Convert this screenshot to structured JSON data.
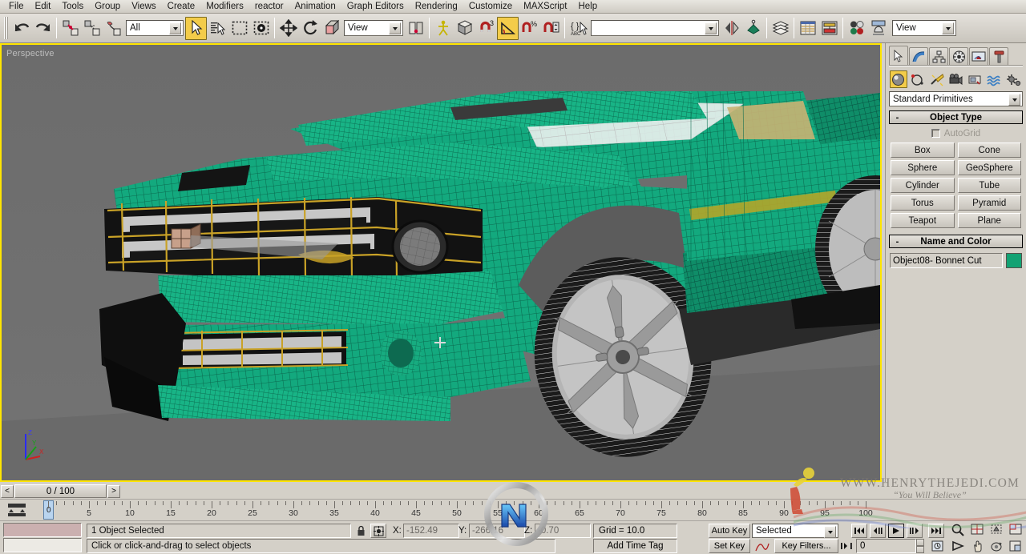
{
  "app": {
    "title": "3ds Max",
    "accent": "#f3cc4a",
    "viewport_border": "#ffe500"
  },
  "menubar": {
    "items": [
      "File",
      "Edit",
      "Tools",
      "Group",
      "Views",
      "Create",
      "Modifiers",
      "reactor",
      "Animation",
      "Graph Editors",
      "Rendering",
      "Customize",
      "MAXScript",
      "Help"
    ]
  },
  "toolbar": {
    "selection_filter": {
      "value": "All",
      "label": "Selection Filter"
    },
    "reference_coord": {
      "value": "View",
      "label": "Reference Coordinate System"
    },
    "named_selection": {
      "value": "",
      "placeholder": ""
    },
    "viewport_layout": {
      "value": "View"
    },
    "icons": [
      "undo-icon",
      "redo-icon",
      "select-link-icon",
      "unlink-icon",
      "bind-space-warp-icon",
      "select-object-icon",
      "select-by-name-icon",
      "rectangular-region-icon",
      "window-crossing-icon",
      "select-and-move-icon",
      "select-and-rotate-icon",
      "select-and-scale-icon",
      "use-pivot-center-icon",
      "select-and-manipulate-icon",
      "snaps-toggle-icon",
      "angle-snap-icon",
      "percent-snap-icon",
      "spinner-snap-icon",
      "named-selection-sets-icon",
      "mirror-icon",
      "align-icon",
      "layer-manager-icon",
      "curve-editor-icon",
      "schematic-view-icon",
      "material-editor-icon",
      "render-setup-icon"
    ]
  },
  "viewport": {
    "label": "Perspective",
    "background": "#6e6e6e",
    "object_color": "#16b083",
    "accent_yellow": "#b09a1e",
    "axis_labels": {
      "x": "X",
      "y": "Y",
      "z": "Z"
    }
  },
  "command_panel": {
    "tabs": [
      {
        "name": "create",
        "icon": "arrow-create-icon",
        "active": true
      },
      {
        "name": "modify",
        "icon": "modify-icon",
        "active": false
      },
      {
        "name": "hierarchy",
        "icon": "hierarchy-icon",
        "active": false
      },
      {
        "name": "motion",
        "icon": "motion-icon",
        "active": false
      },
      {
        "name": "display",
        "icon": "display-icon",
        "active": false
      },
      {
        "name": "utilities",
        "icon": "hammer-icon",
        "active": false
      }
    ],
    "categories": [
      {
        "name": "geometry",
        "icon": "sphere-icon",
        "active": true
      },
      {
        "name": "shapes",
        "icon": "shapes-icon",
        "active": false
      },
      {
        "name": "lights",
        "icon": "light-icon",
        "active": false
      },
      {
        "name": "cameras",
        "icon": "camera-icon",
        "active": false
      },
      {
        "name": "helpers",
        "icon": "helpers-icon",
        "active": false
      },
      {
        "name": "space-warps",
        "icon": "wave-icon",
        "active": false
      },
      {
        "name": "systems",
        "icon": "systems-icon",
        "active": false
      }
    ],
    "category_dropdown": {
      "value": "Standard Primitives"
    },
    "object_type": {
      "rollout_title": "Object Type",
      "expand_state": "-",
      "autogrid_label": "AutoGrid",
      "autogrid_checked": false,
      "buttons": [
        "Box",
        "Cone",
        "Sphere",
        "GeoSphere",
        "Cylinder",
        "Tube",
        "Torus",
        "Pyramid",
        "Teapot",
        "Plane"
      ]
    },
    "name_and_color": {
      "rollout_title": "Name and Color",
      "expand_state": "-",
      "object_name": "Object08- Bonnet Cut",
      "color": "#13a273"
    }
  },
  "timeline": {
    "frame_readout": "0 / 100",
    "prev_label": "<",
    "next_label": ">",
    "range_start": 0,
    "range_end": 100,
    "tick_step": 5,
    "current_frame": 0,
    "tick_labels": [
      0,
      5,
      10,
      15,
      20,
      25,
      30,
      35,
      40,
      45,
      50,
      55,
      60,
      65,
      70,
      75,
      80,
      85,
      90,
      95,
      100
    ]
  },
  "statusbar": {
    "selection_status": "1 Object Selected",
    "prompt": "Click or click-and-drag to select objects",
    "lock_icon": "lock-selection-icon",
    "coord_toggle_icon": "absolute-relative-icon",
    "coords": [
      {
        "axis": "X:",
        "value": "-152.49"
      },
      {
        "axis": "Y:",
        "value": "-266.16"
      },
      {
        "axis": "Z:",
        "value": "-0.70"
      }
    ],
    "grid": "Grid = 10.0",
    "add_time_tag": "Add Time Tag",
    "auto_key": "Auto Key",
    "set_key": "Set Key",
    "key_mode": "Selected",
    "key_filters": "Key Filters...",
    "frame_field": "0",
    "playback": [
      {
        "name": "go-to-start-icon",
        "glyph": "⏮"
      },
      {
        "name": "previous-frame-icon",
        "glyph": "◀"
      },
      {
        "name": "play-animation-icon",
        "glyph": "▶",
        "selected": true
      },
      {
        "name": "next-frame-icon",
        "glyph": "▶"
      },
      {
        "name": "go-to-end-icon",
        "glyph": "⏭"
      }
    ],
    "nav_icons": [
      "zoom-icon",
      "zoom-all-icon",
      "zoom-extents-icon",
      "zoom-region-icon",
      "field-of-view-icon",
      "pan-icon",
      "arc-rotate-icon",
      "maximize-viewport-icon"
    ]
  },
  "watermark": {
    "line1": "WWW.HENRYTHEJEDI.COM",
    "line2": "“You Will Believe”"
  }
}
